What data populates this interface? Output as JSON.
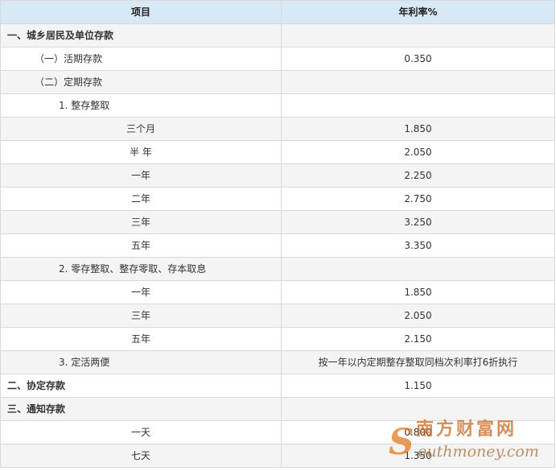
{
  "table": {
    "header": {
      "item": "项目",
      "rate": "年利率%"
    },
    "rows": [
      {
        "item": "一、城乡居民及单位存款",
        "rate": "",
        "level": 0
      },
      {
        "item": "（一）活期存款",
        "rate": "0.350",
        "level": 1
      },
      {
        "item": "（二）定期存款",
        "rate": "",
        "level": 1
      },
      {
        "item": "1. 整存整取",
        "rate": "",
        "level": 2
      },
      {
        "item": "三个月",
        "rate": "1.850",
        "level": 3
      },
      {
        "item": "半 年",
        "rate": "2.050",
        "level": 3
      },
      {
        "item": "一年",
        "rate": "2.250",
        "level": 3
      },
      {
        "item": "二年",
        "rate": "2.750",
        "level": 3
      },
      {
        "item": "三年",
        "rate": "3.250",
        "level": 3
      },
      {
        "item": "五年",
        "rate": "3.350",
        "level": 3
      },
      {
        "item": "2. 零存整取、整存零取、存本取息",
        "rate": "",
        "level": 2
      },
      {
        "item": "一年",
        "rate": "1.850",
        "level": 3
      },
      {
        "item": "三年",
        "rate": "2.050",
        "level": 3
      },
      {
        "item": "五年",
        "rate": "2.150",
        "level": 3
      },
      {
        "item": "3. 定活两便",
        "rate": "按一年以内定期整存整取同档次利率打6折执行",
        "level": 2
      },
      {
        "item": "二、协定存款",
        "rate": "1.150",
        "level": 0
      },
      {
        "item": "三、通知存款",
        "rate": "",
        "level": 0
      },
      {
        "item": "一天",
        "rate": "0.800",
        "level": 3
      },
      {
        "item": "七天",
        "rate": "1.350",
        "level": 3
      }
    ]
  },
  "watermark": {
    "mark": "S",
    "chinese": "南方财富网",
    "english": "outhmoney.com"
  }
}
